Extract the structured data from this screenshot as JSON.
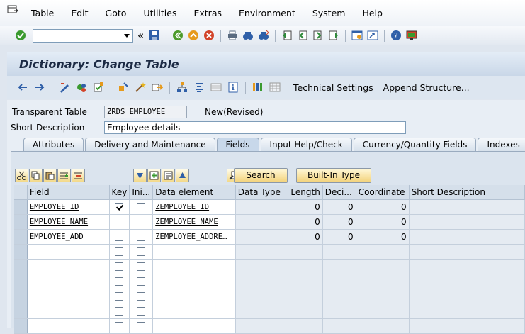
{
  "menubar": {
    "items": [
      "Table",
      "Edit",
      "Goto",
      "Utilities",
      "Extras",
      "Environment",
      "System",
      "Help"
    ]
  },
  "toolbar": {
    "command_value": "",
    "back_symbol": "«",
    "icons": [
      "enter-icon",
      "save-icon",
      "back-icon",
      "exit-icon",
      "cancel-icon",
      "print-icon",
      "find-icon",
      "find-next-icon",
      "first-page-icon",
      "previous-page-icon",
      "next-page-icon",
      "last-page-icon",
      "create-session-icon",
      "shortcut-icon",
      "help-icon",
      "layout-icon"
    ]
  },
  "title": "Dictionary: Change Table",
  "app_toolbar": {
    "technical_settings": "Technical Settings",
    "append_structure": "Append Structure..."
  },
  "header": {
    "type_label": "Transparent Table",
    "table_name": "ZRDS_EMPLOYEE",
    "status": "New(Revised)",
    "short_desc_label": "Short Description",
    "short_desc_value": "Employee details"
  },
  "tabs": [
    {
      "label": "Attributes",
      "active": false
    },
    {
      "label": "Delivery and Maintenance",
      "active": false
    },
    {
      "label": "Fields",
      "active": true
    },
    {
      "label": "Input Help/Check",
      "active": false
    },
    {
      "label": "Currency/Quantity Fields",
      "active": false
    },
    {
      "label": "Indexes",
      "active": false
    }
  ],
  "fields_tab": {
    "search_button": "Search",
    "builtin_button": "Built-In Type",
    "columns": [
      "Field",
      "Key",
      "Ini...",
      "Data element",
      "Data Type",
      "Length",
      "Deci...",
      "Coordinate",
      "Short Description"
    ],
    "rows": [
      {
        "field": "EMPLOYEE_ID",
        "key": true,
        "ini": false,
        "data_element": "ZEMPLOYEE_ID",
        "data_type": "",
        "length": "0",
        "decimals": "0",
        "coordinate": "0",
        "short_description": ""
      },
      {
        "field": "EMPLOYEE_NAME",
        "key": false,
        "ini": false,
        "data_element": "ZEMPLOYEE_NAME",
        "data_type": "",
        "length": "0",
        "decimals": "0",
        "coordinate": "0",
        "short_description": ""
      },
      {
        "field": "EMPLOYEE_ADD",
        "key": false,
        "ini": false,
        "data_element": "ZEMPLOYEE_ADDRE…",
        "data_type": "",
        "length": "0",
        "decimals": "0",
        "coordinate": "0",
        "short_description": ""
      },
      {
        "field": "",
        "key": false,
        "ini": false,
        "data_element": "",
        "data_type": "",
        "length": "",
        "decimals": "",
        "coordinate": "",
        "short_description": ""
      },
      {
        "field": "",
        "key": false,
        "ini": false,
        "data_element": "",
        "data_type": "",
        "length": "",
        "decimals": "",
        "coordinate": "",
        "short_description": ""
      },
      {
        "field": "",
        "key": false,
        "ini": false,
        "data_element": "",
        "data_type": "",
        "length": "",
        "decimals": "",
        "coordinate": "",
        "short_description": ""
      },
      {
        "field": "",
        "key": false,
        "ini": false,
        "data_element": "",
        "data_type": "",
        "length": "",
        "decimals": "",
        "coordinate": "",
        "short_description": ""
      },
      {
        "field": "",
        "key": false,
        "ini": false,
        "data_element": "",
        "data_type": "",
        "length": "",
        "decimals": "",
        "coordinate": "",
        "short_description": ""
      },
      {
        "field": "",
        "key": false,
        "ini": false,
        "data_element": "",
        "data_type": "",
        "length": "",
        "decimals": "",
        "coordinate": "",
        "short_description": ""
      }
    ]
  },
  "colors": {
    "accent": "#1c2a44",
    "background": "#dfe6ef",
    "button": "#f3d27a"
  }
}
